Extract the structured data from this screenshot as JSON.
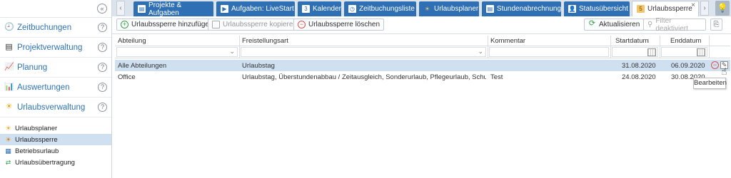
{
  "sidebar": {
    "collapse_glyph": "«",
    "sections": [
      {
        "label": "Zeitbuchungen",
        "icon": "clock-icon",
        "glyph": "🕘"
      },
      {
        "label": "Projektverwaltung",
        "icon": "project-icon",
        "glyph": "▤"
      },
      {
        "label": "Planung",
        "icon": "chart-icon",
        "glyph": "📈"
      },
      {
        "label": "Auswertungen",
        "icon": "bar-chart-icon",
        "glyph": "📊"
      },
      {
        "label": "Urlaubsverwaltung",
        "icon": "sun-icon",
        "glyph": "☀"
      }
    ],
    "help_glyph": "?",
    "subitems": [
      {
        "label": "Urlaubsplaner",
        "glyph": "☀"
      },
      {
        "label": "Urlaubssperre",
        "glyph": "☀",
        "active": true
      },
      {
        "label": "Betriebsurlaub",
        "glyph": "▦"
      },
      {
        "label": "Urlaubsübertragung",
        "glyph": "⇄"
      }
    ]
  },
  "tabs": [
    {
      "label": "Projekte & Aufgaben",
      "glyph": "▤"
    },
    {
      "label": "Aufgaben: LiveStart",
      "glyph": "▶"
    },
    {
      "label": "Kalender",
      "glyph": "3"
    },
    {
      "label": "Zeitbuchungsliste",
      "glyph": "◷"
    },
    {
      "label": "Urlaubsplaner",
      "glyph": "☀"
    },
    {
      "label": "Stundenabrechnung",
      "glyph": "▤"
    },
    {
      "label": "Statusübersicht",
      "glyph": "👤"
    },
    {
      "label": "Urlaubssperre",
      "glyph": "5",
      "active": true
    }
  ],
  "tab_close_glyph": "×",
  "tab_left_glyph": "‹",
  "tab_right_glyph": "›",
  "tab_light_glyph": "💡",
  "toolbar": {
    "add_label": "Urlaubssperre hinzufügen",
    "copy_label": "Urlaubssperre kopieren",
    "delete_label": "Urlaubssperre löschen",
    "refresh_label": "Aktualisieren",
    "filter_label": "Filter deaktiviert",
    "add_glyph": "+",
    "delete_glyph": "−",
    "refresh_glyph": "⟳",
    "filter_glyph": "⚲",
    "export_glyph": "⎘"
  },
  "grid": {
    "columns": [
      "Abteilung",
      "Freistellungsart",
      "Kommentar",
      "Startdatum",
      "Enddatum"
    ],
    "sort_glyph": "↓",
    "rows": [
      {
        "abteilung": "Alle Abteilungen",
        "freistellungsart": "Urlaubstag",
        "kommentar": "",
        "startdatum": "31.08.2020",
        "enddatum": "06.09.2020"
      },
      {
        "abteilung": "Office",
        "freistellungsart": "Urlaubstag, Überstundenabbau / Zeitausgleich, Sonderurlaub, Pflegeurlaub, Schulung, Siedlungs...",
        "kommentar": "Test",
        "startdatum": "24.08.2020",
        "enddatum": "30.08.2020"
      }
    ],
    "row_delete_glyph": "−",
    "row_edit_glyph": "✎",
    "chevron_glyph": "⌄"
  },
  "tooltip": {
    "label": "Bearbeiten"
  },
  "colors": {
    "accent": "#2f6fb3",
    "selected_row": "#cfe0f1",
    "nav_link": "#2f74b5"
  }
}
